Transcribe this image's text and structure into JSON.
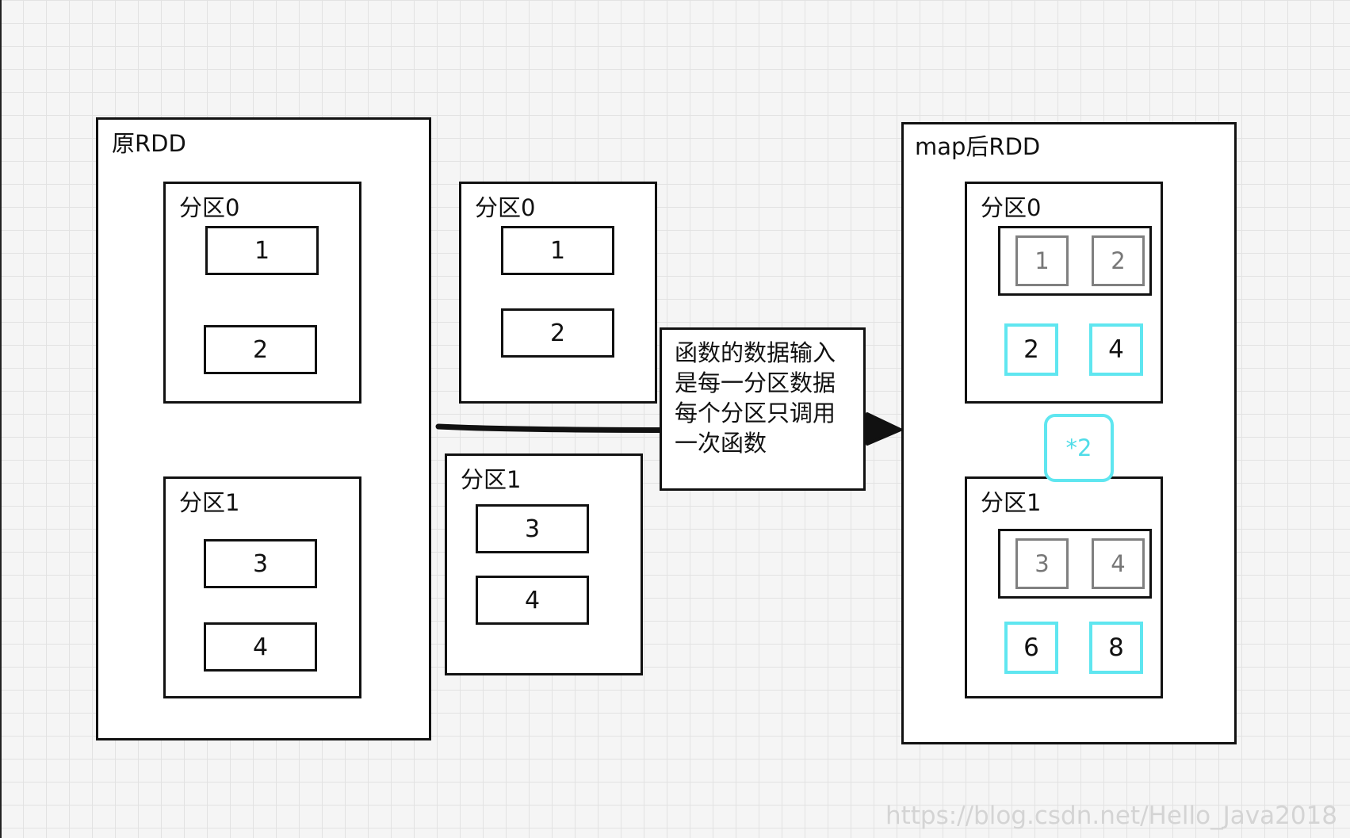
{
  "original_rdd": {
    "title": "原RDD",
    "partition0": {
      "label": "分区0",
      "items": [
        "1",
        "2"
      ]
    },
    "partition1": {
      "label": "分区1",
      "items": [
        "3",
        "4"
      ]
    }
  },
  "middle": {
    "partition0": {
      "label": "分区0",
      "items": [
        "1",
        "2"
      ]
    },
    "partition1": {
      "label": "分区1",
      "items": [
        "3",
        "4"
      ]
    }
  },
  "note": {
    "lines": [
      "函数的数据输入",
      "是每一分区数据",
      "每个分区只调用",
      "一次函数"
    ]
  },
  "mapped_rdd": {
    "title": "map后RDD",
    "partition0": {
      "label": "分区0",
      "inputs": [
        "1",
        "2"
      ],
      "outputs": [
        "2",
        "4"
      ]
    },
    "partition1": {
      "label": "分区1",
      "inputs": [
        "3",
        "4"
      ],
      "outputs": [
        "6",
        "8"
      ]
    },
    "multiplier": "*2"
  },
  "watermark": "https://blog.csdn.net/Hello_Java2018",
  "colors": {
    "accent": "#5fe6f0",
    "line": "#111111",
    "input_gray": "#808080"
  }
}
